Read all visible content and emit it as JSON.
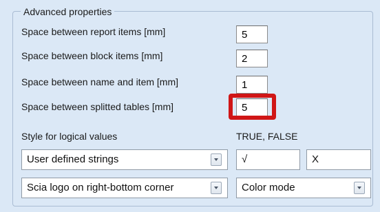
{
  "group": {
    "title": "Advanced properties"
  },
  "rows": [
    {
      "label": "Space between report items [mm]",
      "value": "5"
    },
    {
      "label": "Space between block items [mm]",
      "value": "2"
    },
    {
      "label": "Space between name and item [mm]",
      "value": "1"
    },
    {
      "label": "Space between splitted tables [mm]",
      "value": "5"
    }
  ],
  "logical": {
    "style_label": "Style for logical values",
    "true_false_label": "TRUE, FALSE",
    "style_value": "User defined strings",
    "true_string": "√",
    "false_string": "X"
  },
  "bottom": {
    "logo_value": "Scia logo on right-bottom corner",
    "color_value": "Color mode"
  },
  "colors": {
    "background": "#dbe8f6",
    "highlight": "#d01616"
  },
  "icons": {
    "dropdown": "chevron-down-icon"
  }
}
